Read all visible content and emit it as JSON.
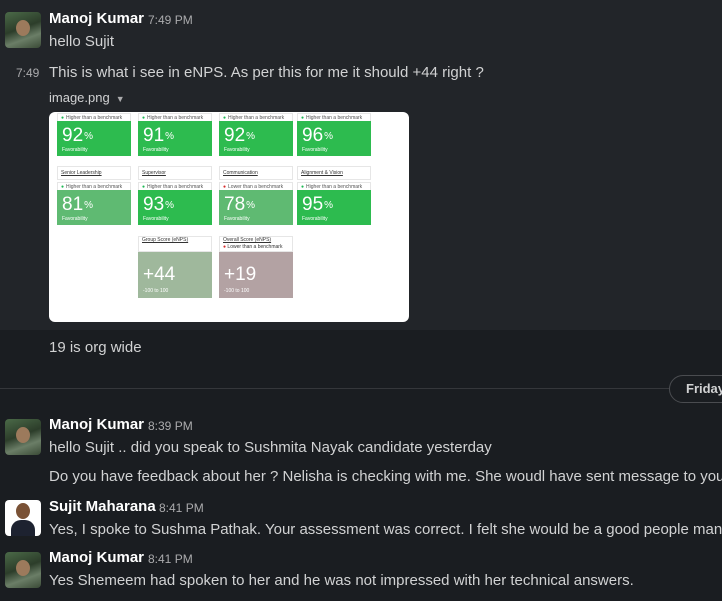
{
  "messages": {
    "m1": {
      "author": "Manoj Kumar",
      "time": "7:49 PM",
      "text": "hello Sujit"
    },
    "m2": {
      "time": "7:49",
      "text": "This is what i see in eNPS. As per this for me it should +44 right ?"
    },
    "attachment": {
      "filename": "image.png",
      "caret": "▼"
    },
    "m3": {
      "text": "19 is org wide"
    },
    "m4": {
      "author": "Manoj Kumar",
      "time": "8:39 PM",
      "text": "hello Sujit .. did you speak to Sushmita Nayak candidate yesterday"
    },
    "m5": {
      "text": "Do you have feedback about her ? Nelisha is checking with me. She woudl have sent message to you as"
    },
    "m6": {
      "author": "Sujit Maharana",
      "time": "8:41 PM",
      "text": "Yes, I spoke to Sushma Pathak. Your assessment was correct. I felt she would be a good people manage"
    },
    "m7": {
      "author": "Manoj Kumar",
      "time": "8:41 PM",
      "text": "Yes Shemeem had spoken to her and he was not impressed with her technical answers."
    }
  },
  "day_divider": {
    "label": "Friday"
  },
  "image": {
    "row1": [
      {
        "tag": "Higher than a benchmark",
        "value": "92",
        "unit": "%",
        "caption": "Favorability"
      },
      {
        "tag": "Higher than a benchmark",
        "value": "91",
        "unit": "%",
        "caption": "Favorability"
      },
      {
        "tag": "Higher than a benchmark",
        "value": "92",
        "unit": "%",
        "caption": "Favorability"
      },
      {
        "tag": "Higher than a benchmark",
        "value": "96",
        "unit": "%",
        "caption": "Favorability"
      }
    ],
    "labels2": [
      "Senior Leadership",
      "Supervisor",
      "Communication",
      "Alignment & Vision"
    ],
    "row2": [
      {
        "tag": "Higher than a benchmark",
        "value": "81",
        "unit": "%",
        "caption": "Favorability"
      },
      {
        "tag": "Higher than a benchmark",
        "value": "93",
        "unit": "%",
        "caption": "Favorability"
      },
      {
        "tag": "Lower than a benchmark",
        "value": "78",
        "unit": "%",
        "caption": "Favorability"
      },
      {
        "tag": "Higher than a benchmark",
        "value": "95",
        "unit": "%",
        "caption": "Favorability"
      }
    ],
    "enps": [
      {
        "title": "Group Score (eNPS)",
        "tag": "",
        "value": "+44",
        "caption": "-100 to 100"
      },
      {
        "title": "Overall Score (eNPS)",
        "tag": "Lower than a benchmark",
        "value": "+19",
        "caption": "-100 to 100"
      }
    ]
  },
  "colors": {
    "background": "#1a1d21",
    "highlight": "#222529",
    "green": "#2dbb4f"
  }
}
